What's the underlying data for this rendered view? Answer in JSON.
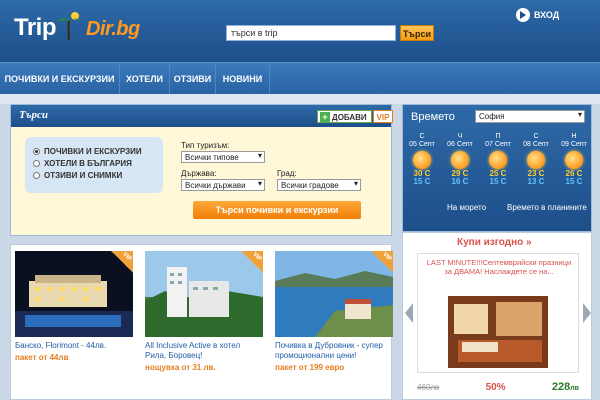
{
  "header": {
    "logo_trip": "Trip",
    "logo_dir": "Dir.bg",
    "search_placeholder": "търси в trip",
    "search_button": "Търси",
    "login": "ВХОД"
  },
  "nav": {
    "items": [
      {
        "label": "ПОЧИВКИ И ЕКСКУРЗИИ"
      },
      {
        "label": "ХОТЕЛИ"
      },
      {
        "label": "ОТЗИВИ"
      },
      {
        "label": "НОВИНИ"
      }
    ]
  },
  "search": {
    "title": "Търси",
    "add_button": "ДОБАВИ",
    "vip_button": "VIP",
    "options": [
      {
        "label": "ПОЧИВКИ И ЕКСКУРЗИИ",
        "selected": true
      },
      {
        "label": "ХОТЕЛИ В БЪЛГАРИЯ",
        "selected": false
      },
      {
        "label": "ОТЗИВИ И СНИМКИ",
        "selected": false
      }
    ],
    "type_label": "Тип туризъм:",
    "type_value": "Всички типове",
    "country_label": "Държава:",
    "country_value": "Всички държави",
    "city_label": "Град:",
    "city_value": "Всички градове",
    "submit": "Търси почивки и екскурзии"
  },
  "weather": {
    "title": "Времето",
    "city": "София",
    "days": [
      {
        "day": "С",
        "date": "05 Септ",
        "max": "30 C",
        "min": "15 C"
      },
      {
        "day": "Ч",
        "date": "06 Септ",
        "max": "29 C",
        "min": "16 C"
      },
      {
        "day": "П",
        "date": "07 Септ",
        "max": "25 C",
        "min": "15 C"
      },
      {
        "day": "С",
        "date": "08 Септ",
        "max": "23 C",
        "min": "13 C"
      },
      {
        "day": "Н",
        "date": "09 Септ",
        "max": "26 C",
        "min": "15 C"
      }
    ],
    "link_sea": "На морето",
    "link_mountain": "Времето в планините"
  },
  "deals": [
    {
      "title": "Банско, Florimont - 44лв.",
      "price": "пакет от 44лв",
      "vip": "VIP"
    },
    {
      "title": "All Inclusive Active в хотел Рила, Боровец!",
      "price": "нощувка от 31 лв.",
      "vip": "VIP"
    },
    {
      "title": "Почивка в Дубровник - супер промоционални цени!",
      "price": "пакет от 199 евро",
      "vip": "VIP"
    }
  ],
  "buy": {
    "title": "Купи изгодно »",
    "text": "LAST MINUTE!!!Септемврийски празници за ДВАМА! Наслаждете се на...",
    "old_price": "460лв",
    "discount": "50%",
    "new_price": "228",
    "currency": "лв"
  }
}
